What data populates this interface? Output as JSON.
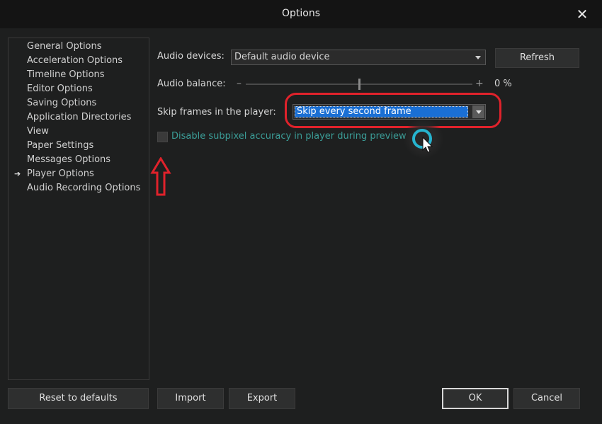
{
  "window": {
    "title": "Options",
    "close_icon": "close-icon"
  },
  "sidebar": {
    "items": [
      {
        "label": "General Options",
        "selected": false
      },
      {
        "label": "Acceleration Options",
        "selected": false
      },
      {
        "label": "Timeline Options",
        "selected": false
      },
      {
        "label": "Editor Options",
        "selected": false
      },
      {
        "label": "Saving Options",
        "selected": false
      },
      {
        "label": "Application Directories",
        "selected": false
      },
      {
        "label": "View",
        "selected": false
      },
      {
        "label": "Paper Settings",
        "selected": false
      },
      {
        "label": "Messages Options",
        "selected": false
      },
      {
        "label": "Player Options",
        "selected": true
      },
      {
        "label": "Audio Recording Options",
        "selected": false
      }
    ],
    "selected_marker": "➔"
  },
  "player": {
    "audio_devices_label": "Audio devices:",
    "audio_devices_value": "Default audio device",
    "refresh_label": "Refresh",
    "audio_balance_label": "Audio balance:",
    "balance_minus": "–",
    "balance_plus": "+",
    "balance_value": "0 %",
    "balance_level": 0.5,
    "skip_label": "Skip frames in the player:",
    "skip_value": "Skip every second frame",
    "subpixel_label": "Disable subpixel accuracy in player during preview",
    "subpixel_checked": false
  },
  "footer": {
    "reset_label": "Reset to defaults",
    "import_label": "Import",
    "export_label": "Export",
    "ok_label": "OK",
    "cancel_label": "Cancel"
  },
  "colors": {
    "annotation_red": "#e0222b",
    "selection_blue": "#1a6fd4",
    "cursor_ring": "#26b4cf",
    "disabled_text": "#3b9d97"
  }
}
